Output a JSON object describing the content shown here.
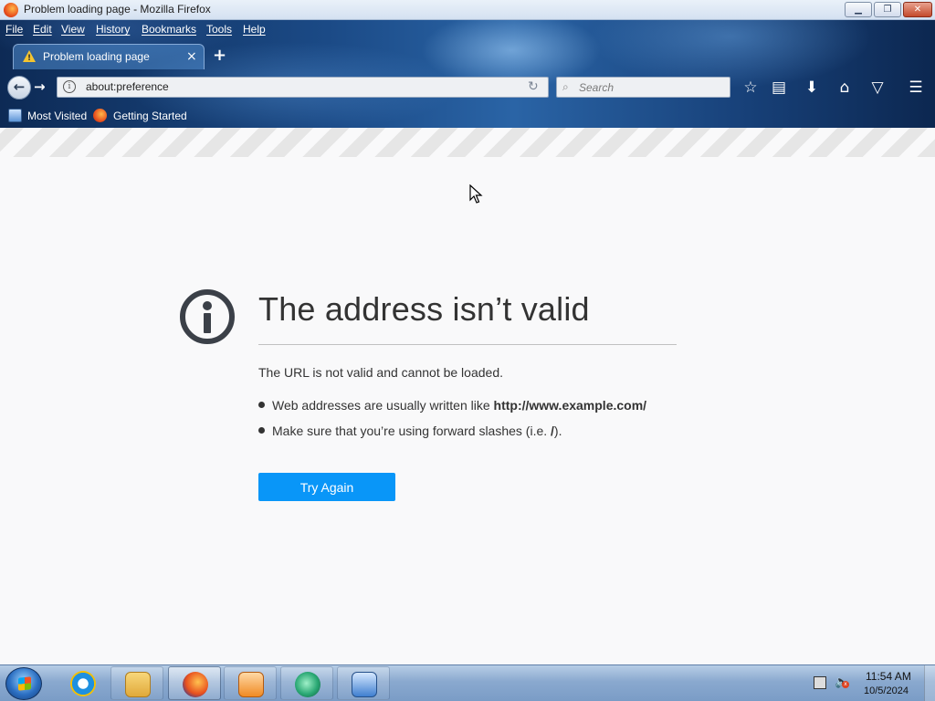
{
  "window": {
    "title": "Problem loading page - Mozilla Firefox",
    "controls": {
      "minimize": "▁",
      "maximize": "❐",
      "close": "✕"
    }
  },
  "menubar": {
    "items": [
      "File",
      "Edit",
      "View",
      "History",
      "Bookmarks",
      "Tools",
      "Help"
    ]
  },
  "tabs": [
    {
      "label": "Problem loading page",
      "icon": "warning-icon",
      "close": "×"
    }
  ],
  "new_tab": "+",
  "navbar": {
    "back": "←",
    "forward": "→",
    "url": "about:preference",
    "reload": "↻",
    "search_icon": "⌕",
    "search_placeholder": "Search"
  },
  "toolbar_icons": {
    "bookmark_star": "☆",
    "reading_list": "▤",
    "downloads": "⬇",
    "home": "⌂",
    "pocket": "▽",
    "menu": "☰"
  },
  "bookmarks": [
    {
      "label": "Most Visited",
      "icon": "most-visited-icon"
    },
    {
      "label": "Getting Started",
      "icon": "firefox-icon"
    }
  ],
  "error": {
    "title": "The address isn’t valid",
    "description": "The URL is not valid and cannot be loaded.",
    "bullets": [
      {
        "text": "Web addresses are usually written like ",
        "bold": "http://www.example.com/",
        "suffix": ""
      },
      {
        "text": "Make sure that you’re using forward slashes (i.e. ",
        "bold": "/",
        "suffix": ")."
      }
    ],
    "button": "Try Again"
  },
  "taskbar": {
    "apps": [
      {
        "name": "internet-explorer",
        "color": "#1e90e0"
      },
      {
        "name": "file-explorer",
        "color": "#e8b84a"
      },
      {
        "name": "firefox",
        "color": "#e8501e"
      },
      {
        "name": "media-player",
        "color": "#f08a24"
      },
      {
        "name": "app-green",
        "color": "#2aa874"
      },
      {
        "name": "control-panel",
        "color": "#3f7fd0"
      }
    ],
    "clock": {
      "time": "11:54 AM",
      "date": "10/5/2024"
    }
  },
  "colors": {
    "accent_button": "#0996f8",
    "text_dark": "#333333"
  }
}
